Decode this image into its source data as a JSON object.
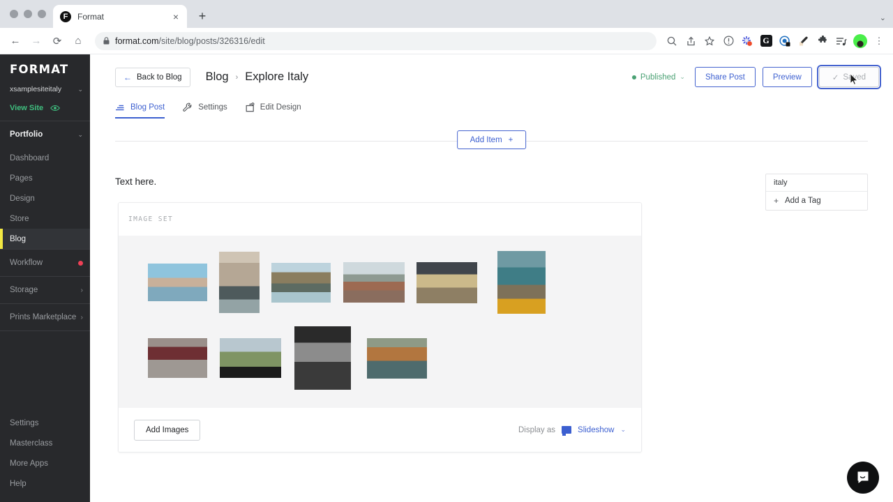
{
  "browser": {
    "tab": {
      "title": "Format",
      "favicon_letter": "F",
      "close_label": "×"
    },
    "new_tab_label": "+",
    "tabstrip_chevron": "⌄",
    "nav": {
      "back": "←",
      "forward": "→",
      "reload": "⟳",
      "home": "⌂"
    },
    "address": {
      "lock_icon": "lock-icon",
      "domain": "format.com",
      "path": "/site/blog/posts/326316/edit"
    },
    "toolbar_icons": [
      "search-icon",
      "share-icon",
      "bookmark-star-icon",
      "info-circle-icon",
      "colorburst-extension-icon",
      "grammarly-icon",
      "privacy-badger-icon",
      "eyedropper-icon",
      "puzzle-extensions-icon",
      "reading-list-icon",
      "profile-avatar",
      "chrome-menu-icon"
    ],
    "grammarly_letter": "G",
    "menu_dots": "⋮"
  },
  "sidebar": {
    "brand": "FORMAT",
    "site_name": "xsamplesiteitaly",
    "site_chevron": "⌄",
    "view_site_label": "View Site",
    "section": {
      "label": "Portfolio",
      "chevron": "⌄"
    },
    "items": [
      {
        "label": "Dashboard",
        "active": false
      },
      {
        "label": "Pages",
        "active": false
      },
      {
        "label": "Design",
        "active": false
      },
      {
        "label": "Store",
        "active": false
      },
      {
        "label": "Blog",
        "active": true
      }
    ],
    "workflow": {
      "label": "Workflow",
      "badge": "dot"
    },
    "storage": {
      "label": "Storage",
      "chevron": "›"
    },
    "prints": {
      "label": "Prints Marketplace",
      "chevron": "›"
    },
    "bottom_items": [
      {
        "label": "Settings"
      },
      {
        "label": "Masterclass"
      },
      {
        "label": "More Apps"
      },
      {
        "label": "Help"
      }
    ],
    "accent_color": "#f2e843",
    "green_color": "#3fbf7f"
  },
  "header": {
    "back_button": "Back to Blog",
    "back_arrow": "←",
    "breadcrumb_root": "Blog",
    "breadcrumb_separator": "›",
    "breadcrumb_current": "Explore Italy",
    "status": {
      "label": "Published",
      "chevron": "⌄",
      "color": "#4aa173"
    },
    "share_button": "Share Post",
    "preview_button": "Preview",
    "saved_button": "Saved",
    "saved_check": "✓"
  },
  "tabs": [
    {
      "label": "Blog Post",
      "icon": "blog-post-icon",
      "active": true
    },
    {
      "label": "Settings",
      "icon": "wrench-icon",
      "active": false
    },
    {
      "label": "Edit Design",
      "icon": "edit-design-icon",
      "active": false
    }
  ],
  "canvas": {
    "add_item_label": "Add Item",
    "add_item_plus": "+",
    "text_block": "Text here."
  },
  "image_set": {
    "header_label": "IMAGE SET",
    "add_images_label": "Add Images",
    "display_as_label": "Display as",
    "display_mode": "Slideshow",
    "display_chevron": "⌄",
    "rows": [
      [
        {
          "name": "venice-grand-canal",
          "w": 85,
          "h": 54,
          "ml": 22,
          "bg": "linear-gradient(180deg,#8fc4dd 0 38%,#c8b09a 38% 62%,#7fa9bd 62% 100%)"
        },
        {
          "name": "venice-narrow-canal",
          "w": 58,
          "h": 88,
          "ml": 17,
          "bg": "linear-gradient(180deg,#cfc4b4 0 18%,#b5a795 18% 56%,#4e5a5c 56% 78%,#93a3a5 78% 100%)"
        },
        {
          "name": "manarola-cliffs",
          "w": 85,
          "h": 57,
          "ml": 17,
          "bg": "linear-gradient(180deg,#bdd3dd 0 24%,#8a7d5f 24% 52%,#5d6b62 52% 74%,#a9c5cd 74% 100%)"
        },
        {
          "name": "florence-duomo",
          "w": 88,
          "h": 58,
          "ml": 18,
          "bg": "linear-gradient(180deg,#cfd9dd 0 30%,#8e9a92 30% 48%,#9d6a52 48% 70%,#8a6d5e 70% 100%)"
        },
        {
          "name": "pasta-making",
          "w": 87,
          "h": 59,
          "ml": 17,
          "bg": "linear-gradient(180deg,#40454b 0 30%,#cbb98a 30% 62%,#8e7f64 62% 100%)"
        },
        {
          "name": "vernazza-coast",
          "w": 69,
          "h": 90,
          "ml": 29,
          "bg": "linear-gradient(180deg,#6f9aa3 0 26%,#3f7d86 26% 54%,#7d7159 54% 76%,#d8a021 76% 100%)"
        }
      ],
      [
        {
          "name": "wine-toast",
          "w": 85,
          "h": 57,
          "ml": 22,
          "bg": "linear-gradient(180deg,#9a8f8a 0 22%,#6e2f33 22% 54%,#9e9893 54% 100%)"
        },
        {
          "name": "vineyard-wine-glass",
          "w": 88,
          "h": 57,
          "ml": 18,
          "bg": "linear-gradient(180deg,#b8c7cf 0 34%,#7f9464 34% 72%,#1b1b1b 72% 100%)"
        },
        {
          "name": "photographer-bw",
          "w": 81,
          "h": 91,
          "ml": 19,
          "bg": "linear-gradient(180deg,#2a2a2a 0 26%,#8c8c8c 26% 56%,#3a3a3a 56% 100%)"
        },
        {
          "name": "riomaggiore-village",
          "w": 86,
          "h": 58,
          "ml": 23,
          "bg": "linear-gradient(180deg,#8e9a86 0 22%,#b2763f 22% 56%,#4e6b6d 56% 100%)"
        }
      ]
    ]
  },
  "tags": {
    "items": [
      {
        "label": "italy"
      }
    ],
    "add_label": "Add a Tag",
    "add_plus": "+"
  },
  "intercom": {
    "name": "intercom-chat-button"
  }
}
